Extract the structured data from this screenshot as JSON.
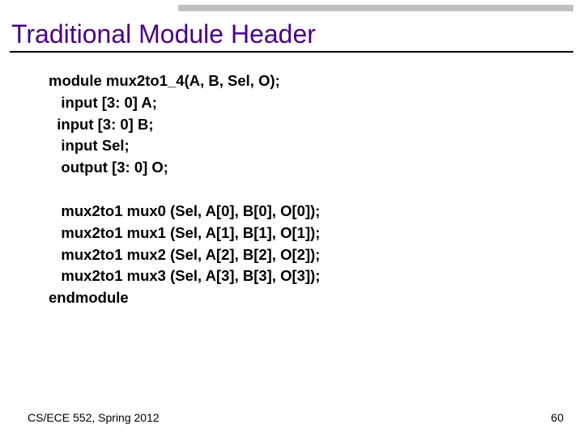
{
  "title": "Traditional Module Header",
  "code": {
    "l0": "module mux2to1_4(A, B, Sel, O);",
    "l1": "   input [3: 0] A;",
    "l2": "  input [3: 0] B;",
    "l3": "   input Sel;",
    "l4": "   output [3: 0] O;",
    "blank1": "",
    "l5": "   mux2to1 mux0 (Sel, A[0], B[0], O[0]);",
    "l6": "   mux2to1 mux1 (Sel, A[1], B[1], O[1]);",
    "l7": "   mux2to1 mux2 (Sel, A[2], B[2], O[2]);",
    "l8": "   mux2to1 mux3 (Sel, A[3], B[3], O[3]);",
    "l9": "endmodule"
  },
  "footer": {
    "left": "CS/ECE 552, Spring 2012",
    "right": "60"
  }
}
